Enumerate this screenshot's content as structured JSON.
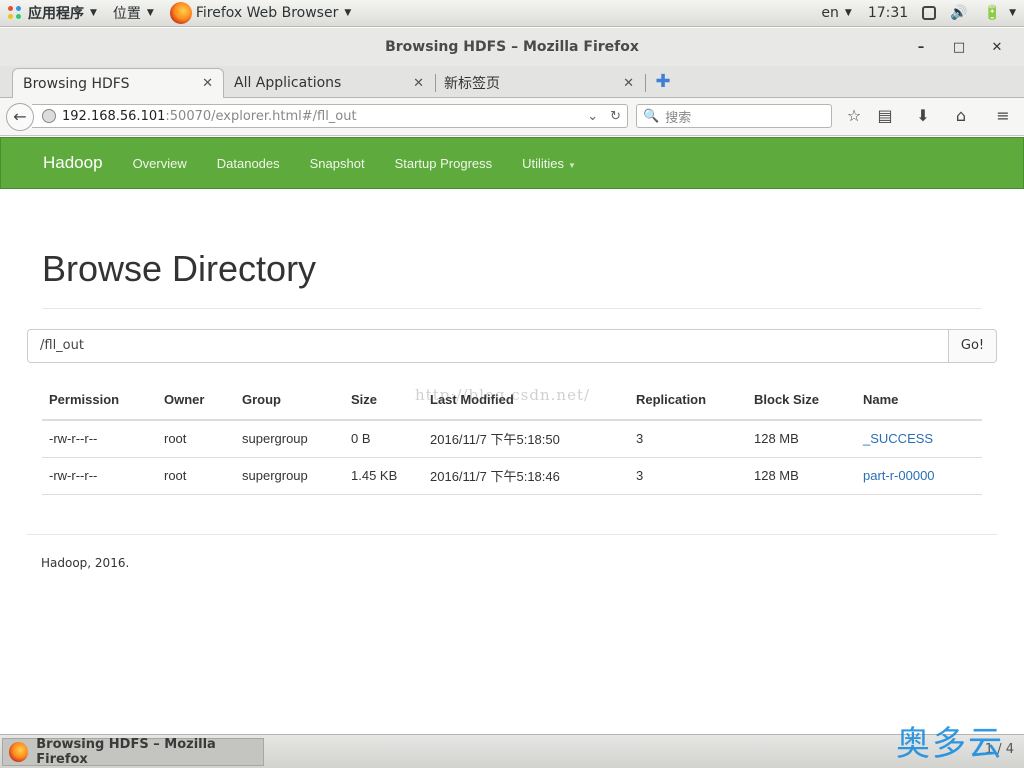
{
  "topbar": {
    "applications": "应用程序",
    "places": "位置",
    "active_app": "Firefox Web Browser",
    "lang": "en",
    "clock": "17:31"
  },
  "window": {
    "title": "Browsing HDFS – Mozilla Firefox",
    "minimize": "–",
    "maximize": "□",
    "close": "✕"
  },
  "tabs": [
    {
      "label": "Browsing HDFS",
      "close": "✕"
    },
    {
      "label": "All Applications",
      "close": "✕"
    },
    {
      "label": "新标签页",
      "close": "✕"
    }
  ],
  "new_tab": "✚",
  "urlbar": {
    "host": "192.168.56.101",
    "rest": ":50070/explorer.html#/fll_out"
  },
  "search": {
    "placeholder": "搜索"
  },
  "hadoop_nav": {
    "brand": "Hadoop",
    "links": [
      "Overview",
      "Datanodes",
      "Snapshot",
      "Startup Progress",
      "Utilities"
    ]
  },
  "page": {
    "title": "Browse Directory",
    "path_value": "/fll_out",
    "go_label": "Go!",
    "watermark": "http://blog.csdn.net/",
    "footer": "Hadoop, 2016."
  },
  "table": {
    "headers": [
      "Permission",
      "Owner",
      "Group",
      "Size",
      "Last Modified",
      "Replication",
      "Block Size",
      "Name"
    ],
    "rows": [
      [
        "-rw-r--r--",
        "root",
        "supergroup",
        "0 B",
        "2016/11/7 下午5:18:50",
        "3",
        "128 MB",
        "_SUCCESS"
      ],
      [
        "-rw-r--r--",
        "root",
        "supergroup",
        "1.45 KB",
        "2016/11/7 下午5:18:46",
        "3",
        "128 MB",
        "part-r-00000"
      ]
    ]
  },
  "taskbar": {
    "window_button": "Browsing HDFS – Mozilla Firefox",
    "pager": "1 / 4"
  },
  "corner_logo": "奥多云",
  "colors": {
    "hadoop_green": "#5eaa3d",
    "link_blue": "#2a6eb5"
  }
}
